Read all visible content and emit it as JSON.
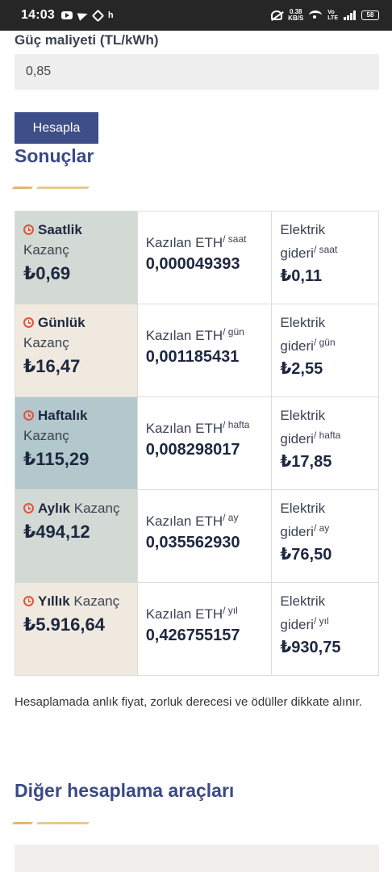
{
  "status_bar": {
    "time": "14:03",
    "notif_h": "h",
    "speed_value": "0.38",
    "speed_unit": "KB/S",
    "volte_top": "Vo",
    "volte_bottom": "LTE",
    "battery": "58"
  },
  "form": {
    "cost_label": "Güç maliyeti (TL/kWh)",
    "cost_value": "0,85",
    "calc_button": "Hesapla"
  },
  "results": {
    "title": "Sonuçlar",
    "rows": [
      {
        "period": "Saatlik",
        "kazanc_label": "Kazanç",
        "kazanc": "₺0,69",
        "eth_label": "Kazılan ETH",
        "eth_unit": "/ saat",
        "eth": "0,000049393",
        "el_label_1": "Elektrik",
        "el_label_2": "gideri",
        "el_unit": "/ saat",
        "el": "₺0,11",
        "bg": "#d3dad5"
      },
      {
        "period": "Günlük",
        "kazanc_label": "Kazanç",
        "kazanc": "₺16,47",
        "eth_label": "Kazılan ETH",
        "eth_unit": "/ gün",
        "eth": "0,001185431",
        "el_label_1": "Elektrik",
        "el_label_2": "gideri",
        "el_unit": "/ gün",
        "el": "₺2,55",
        "bg": "#efe9df"
      },
      {
        "period": "Haftalık",
        "kazanc_label": "Kazanç",
        "kazanc": "₺115,29",
        "eth_label": "Kazılan ETH",
        "eth_unit": "/ hafta",
        "eth": "0,008298017",
        "el_label_1": "Elektrik",
        "el_label_2": "gideri",
        "el_unit": "/ hafta",
        "el": "₺17,85",
        "bg": "#b3c8cd"
      },
      {
        "period": "Aylık",
        "kazanc_label": "Kazanç",
        "kazanc": "₺494,12",
        "eth_label": "Kazılan ETH",
        "eth_unit": "/ ay",
        "eth": "0,035562930",
        "el_label_1": "Elektrik",
        "el_label_2": "gideri",
        "el_unit": "/ ay",
        "el": "₺76,50",
        "bg": "#d3dad5"
      },
      {
        "period": "Yıllık",
        "kazanc_label": "Kazanç",
        "kazanc": "₺5.916,64",
        "eth_label": "Kazılan ETH",
        "eth_unit": "/ yıl",
        "eth": "0,426755157",
        "el_label_1": "Elektrik",
        "el_label_2": "gideri",
        "el_unit": "/ yıl",
        "el": "₺930,75",
        "bg": "#efe9df"
      }
    ]
  },
  "note": "Hesaplamada anlık fiyat, zorluk derecesi ve ödüller dikkate alınır.",
  "other_tools": {
    "title": "Diğer hesaplama araçları"
  },
  "colors": {
    "accent": "#3d4e89",
    "title": "#3a4a86",
    "clock": "#e2533d",
    "deco": "#e2b678"
  }
}
